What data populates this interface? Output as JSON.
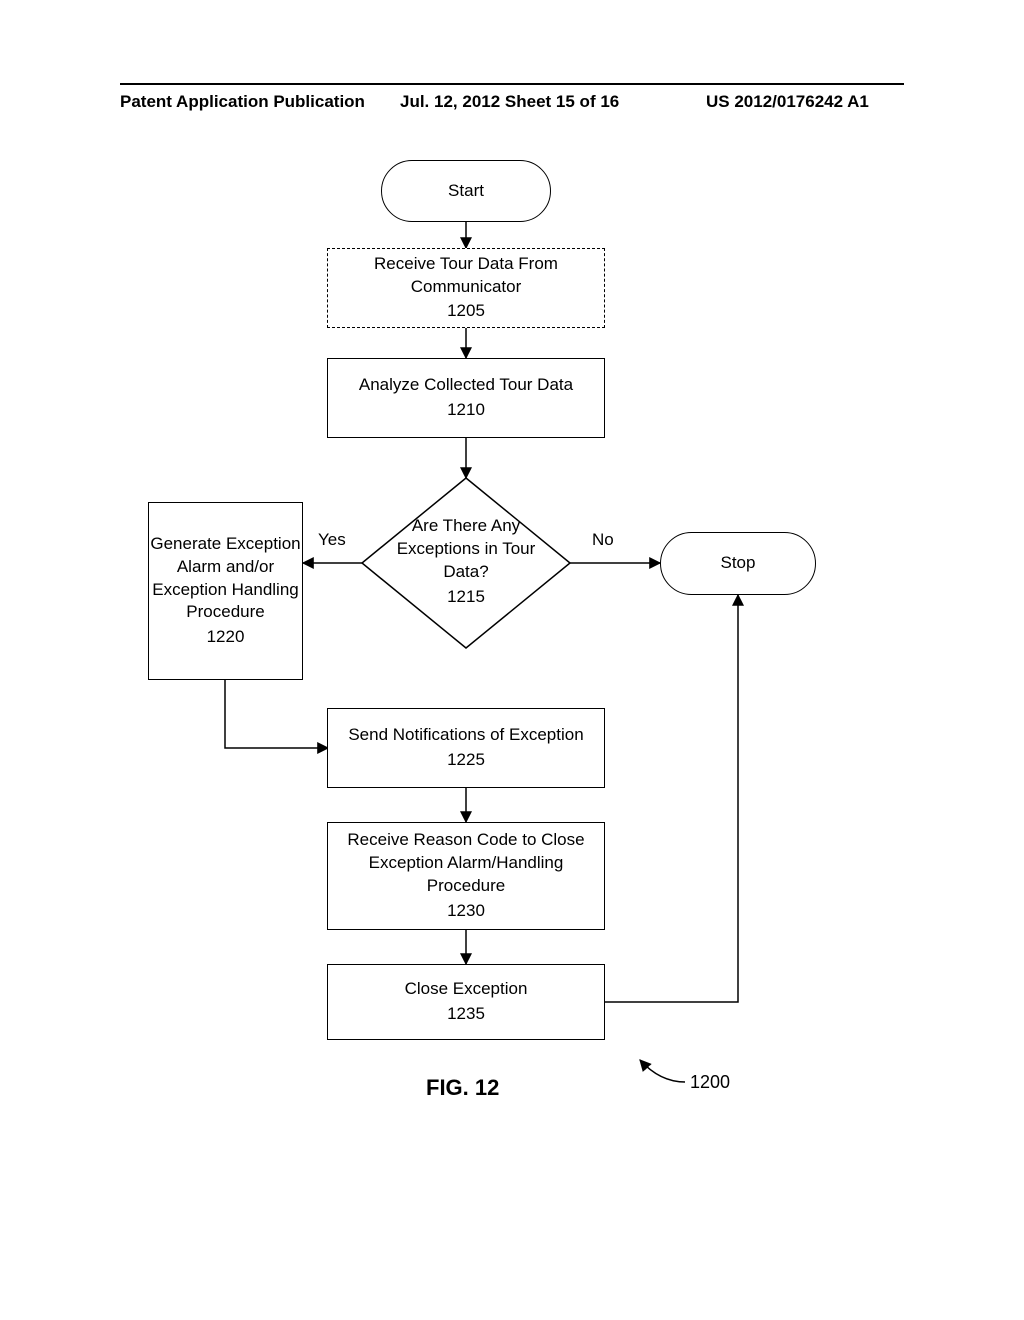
{
  "header": {
    "left": "Patent Application Publication",
    "mid": "Jul. 12, 2012  Sheet 15 of 16",
    "right": "US 2012/0176242 A1"
  },
  "nodes": {
    "start": "Start",
    "n1205": {
      "text": "Receive Tour Data From Communicator",
      "num": "1205"
    },
    "n1210": {
      "text": "Analyze Collected Tour Data",
      "num": "1210"
    },
    "n1215": {
      "text": "Are There Any Exceptions in Tour Data?",
      "num": "1215"
    },
    "n1220": {
      "text": "Generate Exception Alarm and/or Exception Handling Procedure",
      "num": "1220"
    },
    "n1225": {
      "text": "Send Notifications of Exception",
      "num": "1225"
    },
    "n1230": {
      "text": "Receive Reason Code to Close Exception Alarm/Handling Procedure",
      "num": "1230"
    },
    "n1235": {
      "text": "Close Exception",
      "num": "1235"
    },
    "stop": "Stop"
  },
  "edges": {
    "yes": "Yes",
    "no": "No"
  },
  "figure": {
    "label": "FIG. 12",
    "ref": "1200"
  }
}
